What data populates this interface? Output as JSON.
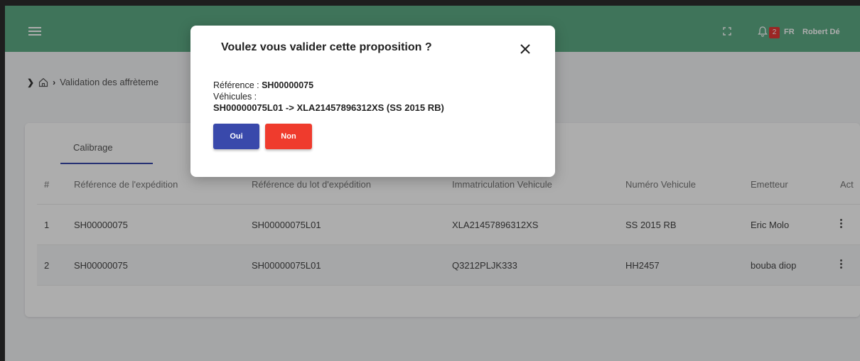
{
  "header": {
    "notification_count": "2",
    "language": "FR",
    "user_name": "Robert Dé"
  },
  "breadcrumb": {
    "current": "Validation des affrèteme"
  },
  "tabs": [
    {
      "label": "Calibrage"
    }
  ],
  "table": {
    "columns": [
      "#",
      "Référence de l'expédition",
      "Référence du lot d'expédition",
      "Immatriculation Vehicule",
      "Numéro Vehicule",
      "Emetteur",
      "Act"
    ],
    "rows": [
      {
        "num": "1",
        "ref": "SH00000075",
        "lot": "SH00000075L01",
        "immat": "XLA21457896312XS",
        "numero": "SS 2015 RB",
        "emetteur": "Eric Molo"
      },
      {
        "num": "2",
        "ref": "SH00000075",
        "lot": "SH00000075L01",
        "immat": "Q3212PLJK333",
        "numero": "HH2457",
        "emetteur": "bouba diop"
      }
    ]
  },
  "modal": {
    "title": "Voulez vous valider cette proposition ?",
    "reference_label": "Référence : ",
    "reference_value": "SH00000075",
    "vehicles_label": "Véhicules :",
    "vehicle_line": "SH00000075L01 -> XLA21457896312XS (SS 2015 RB)",
    "yes_label": "Oui",
    "no_label": "Non"
  },
  "colors": {
    "header": "#5dab85",
    "primary": "#3949ab",
    "danger": "#ef3b2d"
  }
}
